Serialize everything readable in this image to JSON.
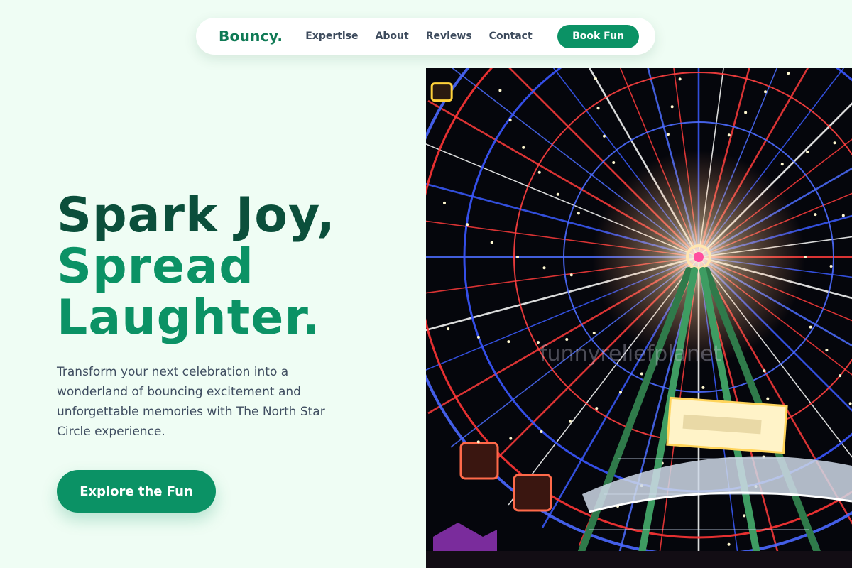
{
  "brand": {
    "name": "Bouncy."
  },
  "nav": {
    "links": [
      "Expertise",
      "About",
      "Reviews",
      "Contact"
    ],
    "cta_label": "Book Fun"
  },
  "hero": {
    "title_line1": "Spark Joy,",
    "title_line2": "Spread",
    "title_line3": "Laughter.",
    "description": "Transform your next celebration into a wonderland of bouncing excitement and unforgettable memories with The North Star Circle experience.",
    "cta_label": "Explore the Fun"
  },
  "image": {
    "subject": "illuminated ferris wheel at night",
    "watermark": "funnyreliefplanet"
  },
  "colors": {
    "background": "#effdf4",
    "brand_green": "#0b9265",
    "dark_green": "#0b4f3b",
    "text_gray": "#3f4d60"
  }
}
